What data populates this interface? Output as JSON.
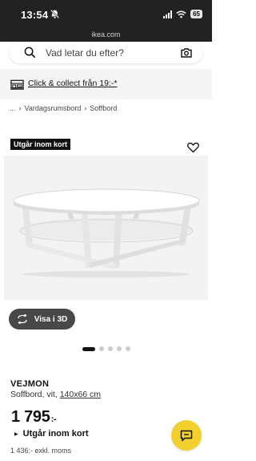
{
  "status_bar": {
    "time": "13:54",
    "battery": "65"
  },
  "browser": {
    "url": "ikea.com"
  },
  "search": {
    "placeholder": "Vad letar du efter?"
  },
  "collect_banner": {
    "text": "Click & collect från 19:-*"
  },
  "breadcrumb": {
    "ellipsis": "...",
    "items": [
      "Vardagsrumsbord",
      "Soffbord"
    ]
  },
  "product": {
    "badge": "Utgår inom kort",
    "view_3d_label": "Visa i 3D",
    "carousel": {
      "total": 5,
      "active": 1
    },
    "name": "VEJMON",
    "description": "Soffbord, vit,",
    "size": "140x66 cm",
    "price_main": "1 795",
    "price_suffix": ":-",
    "stock_status": "Utgår inom kort",
    "vat_note": "1 436:- exkl. moms"
  },
  "icons": [
    "bell-off-icon",
    "signal-icon",
    "wifi-icon",
    "search-icon",
    "camera-icon",
    "truck-icon",
    "heart-icon",
    "cycle-icon",
    "chat-icon"
  ],
  "colors": {
    "top_bar": "#222222",
    "chat_button": "#f2d12e",
    "badge": "#111111"
  }
}
